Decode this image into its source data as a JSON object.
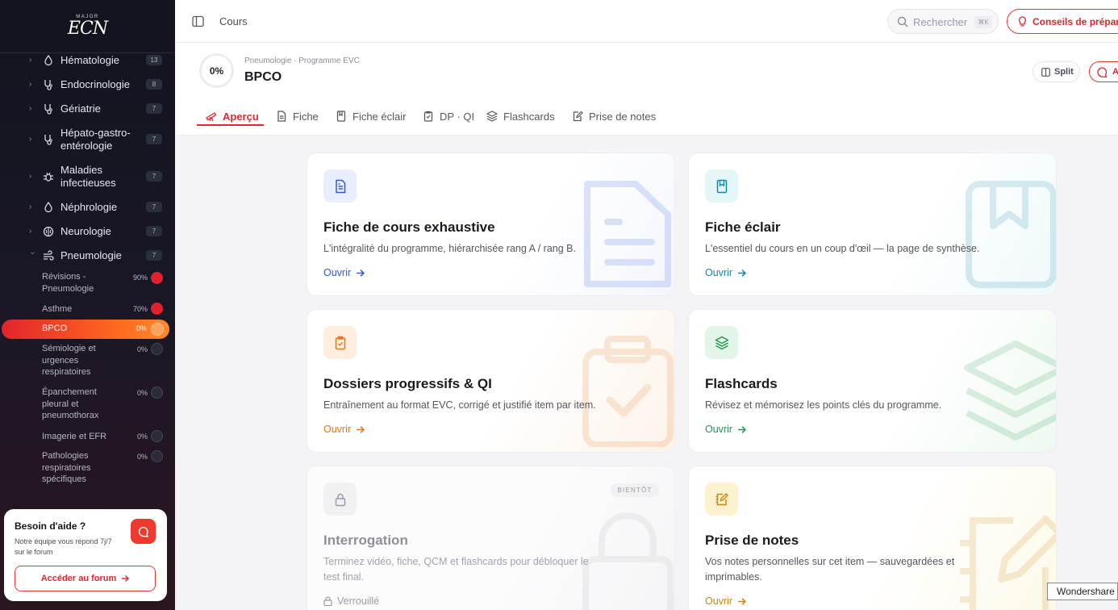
{
  "logo": {
    "top": "MAJOR",
    "main": "ECN"
  },
  "sidebar": {
    "items": [
      {
        "label": "Hématologie",
        "count": "13"
      },
      {
        "label": "Endocrinologie",
        "count": "8"
      },
      {
        "label": "Gériatrie",
        "count": "7"
      },
      {
        "label": "Hépato-gastro-\nentérologie",
        "count": "7"
      },
      {
        "label": "Maladies\ninfectieuses",
        "count": "7"
      },
      {
        "label": "Néphrologie",
        "count": "7"
      },
      {
        "label": "Neurologie",
        "count": "7"
      },
      {
        "label": "Pneumologie",
        "count": "7"
      }
    ],
    "sub_items": [
      {
        "label": "Révisions -\nPneumologie",
        "pct": "90%",
        "progress": 0.9
      },
      {
        "label": "Asthme",
        "pct": "70%",
        "progress": 0.7
      },
      {
        "label": "BPCO",
        "pct": "0%",
        "progress": 0,
        "active": true
      },
      {
        "label": "Sémiologie et\nurgences\nrespiratoires",
        "pct": "0%",
        "progress": 0
      },
      {
        "label": "Épanchement\npleural et\npneumothorax",
        "pct": "0%",
        "progress": 0
      },
      {
        "label": "Imagerie et EFR",
        "pct": "0%",
        "progress": 0
      },
      {
        "label": "Pathologies\nrespiratoires\nspécifiques",
        "pct": "0%",
        "progress": 0
      }
    ]
  },
  "help": {
    "title": "Besoin d'aide ?",
    "desc": "Notre équipe vous répond 7j/7 sur le forum",
    "button": "Accéder au forum"
  },
  "topbar": {
    "crumb": "Cours",
    "search_placeholder": "Rechercher",
    "search_kbd": "⌘K",
    "conseils": "Conseils de prépara"
  },
  "header": {
    "progress": "0%",
    "subtitle": "Pneumologie · Programme EVC",
    "title": "BPCO",
    "split": "Split",
    "ask": "A"
  },
  "tabs": [
    {
      "label": "Aperçu",
      "active": true
    },
    {
      "label": "Fiche"
    },
    {
      "label": "Fiche éclair"
    },
    {
      "label": "DP · QI"
    },
    {
      "label": "Flashcards"
    },
    {
      "label": "Prise de notes"
    }
  ],
  "cards": [
    {
      "title": "Fiche de cours exhaustive",
      "desc": "L'intégralité du programme, hiérarchisée rang A / rang B.",
      "link": "Ouvrir",
      "color": "#2f5bd6",
      "icon": "document-icon"
    },
    {
      "title": "Fiche éclair",
      "desc": "L'essentiel du cours en un coup d'œil — la page de synthèse.",
      "link": "Ouvrir",
      "color": "#0e8aa6",
      "icon": "book-icon"
    },
    {
      "title": "Dossiers progressifs & QI",
      "desc": "Entraînement au format EVC, corrigé et justifié item par item.",
      "link": "Ouvrir",
      "color": "#e0781b",
      "icon": "clipboard-check-icon"
    },
    {
      "title": "Flashcards",
      "desc": "Révisez et mémorisez les points clés du programme.",
      "link": "Ouvrir",
      "color": "#1f9a52",
      "icon": "layers-icon"
    },
    {
      "title": "Interrogation",
      "desc": "Terminez vidéo, fiche, QCM et flashcards pour débloquer le test final.",
      "link": "Verrouillé",
      "badge": "BIENTÔT",
      "color": "#9a9ca6",
      "icon": "lock-icon"
    },
    {
      "title": "Prise de notes",
      "desc": "Vos notes personnelles sur cet item — sauvegardées et imprimables.",
      "link": "Ouvrir",
      "color": "#c8860a",
      "icon": "edit-note-icon"
    }
  ],
  "overlay": {
    "wondershare": "Wondershare"
  }
}
